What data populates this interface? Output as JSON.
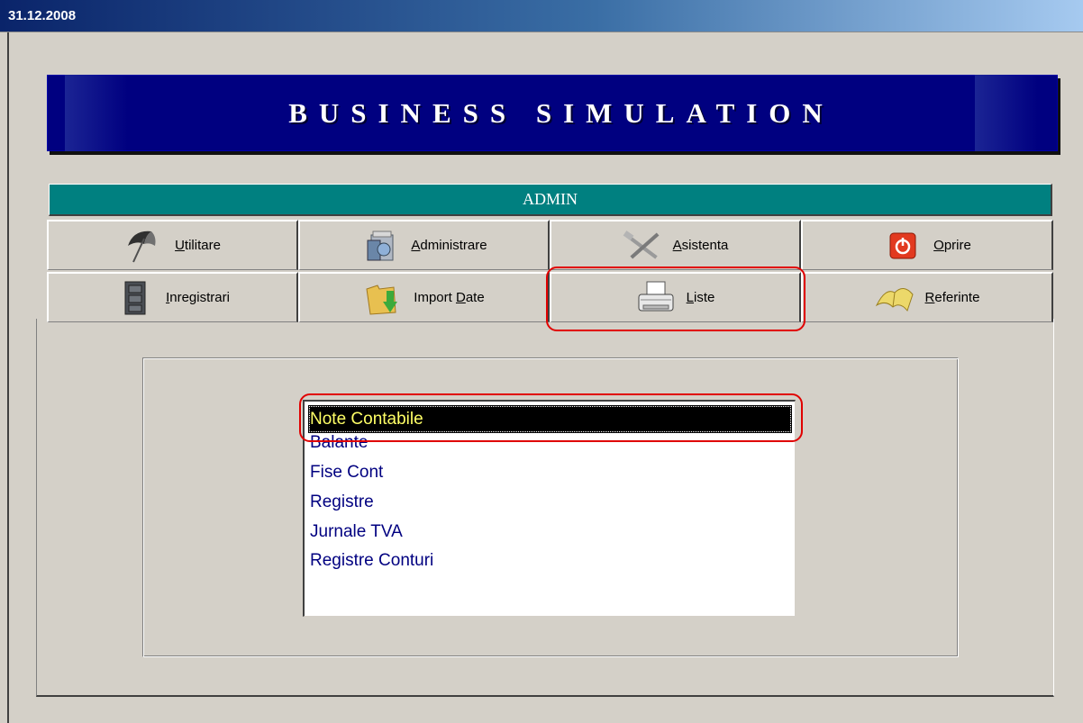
{
  "window": {
    "date": "31.12.2008"
  },
  "banner": {
    "title": "BUSINESS SIMULATION"
  },
  "section": {
    "header": "ADMIN"
  },
  "tabs": [
    {
      "label_pre": "",
      "label_key": "U",
      "label_post": "tilitare",
      "icon": "umbrella-icon"
    },
    {
      "label_pre": "",
      "label_key": "A",
      "label_post": "dministrare",
      "icon": "admin-tools-icon"
    },
    {
      "label_pre": "",
      "label_key": "A",
      "label_post": "sistenta",
      "icon": "tools-wrench-icon"
    },
    {
      "label_pre": "",
      "label_key": "O",
      "label_post": "prire",
      "icon": "power-icon"
    },
    {
      "label_pre": "",
      "label_key": "I",
      "label_post": "nregistrari",
      "icon": "filing-cabinet-icon"
    },
    {
      "label_pre": "Import ",
      "label_key": "D",
      "label_post": "ate",
      "icon": "folder-import-icon"
    },
    {
      "label_pre": "",
      "label_key": "L",
      "label_post": "iste",
      "icon": "printer-icon"
    },
    {
      "label_pre": "",
      "label_key": "R",
      "label_post": "eferinte",
      "icon": "book-icon"
    }
  ],
  "list": {
    "items": [
      "Note Contabile",
      "Balante",
      "Fise Cont",
      "Registre",
      "Jurnale TVA",
      "Registre Conturi"
    ],
    "selected": "Note Contabile"
  },
  "colors": {
    "accent": "#e00000",
    "banner": "#000080",
    "header": "#008080",
    "list_text": "#000080"
  }
}
